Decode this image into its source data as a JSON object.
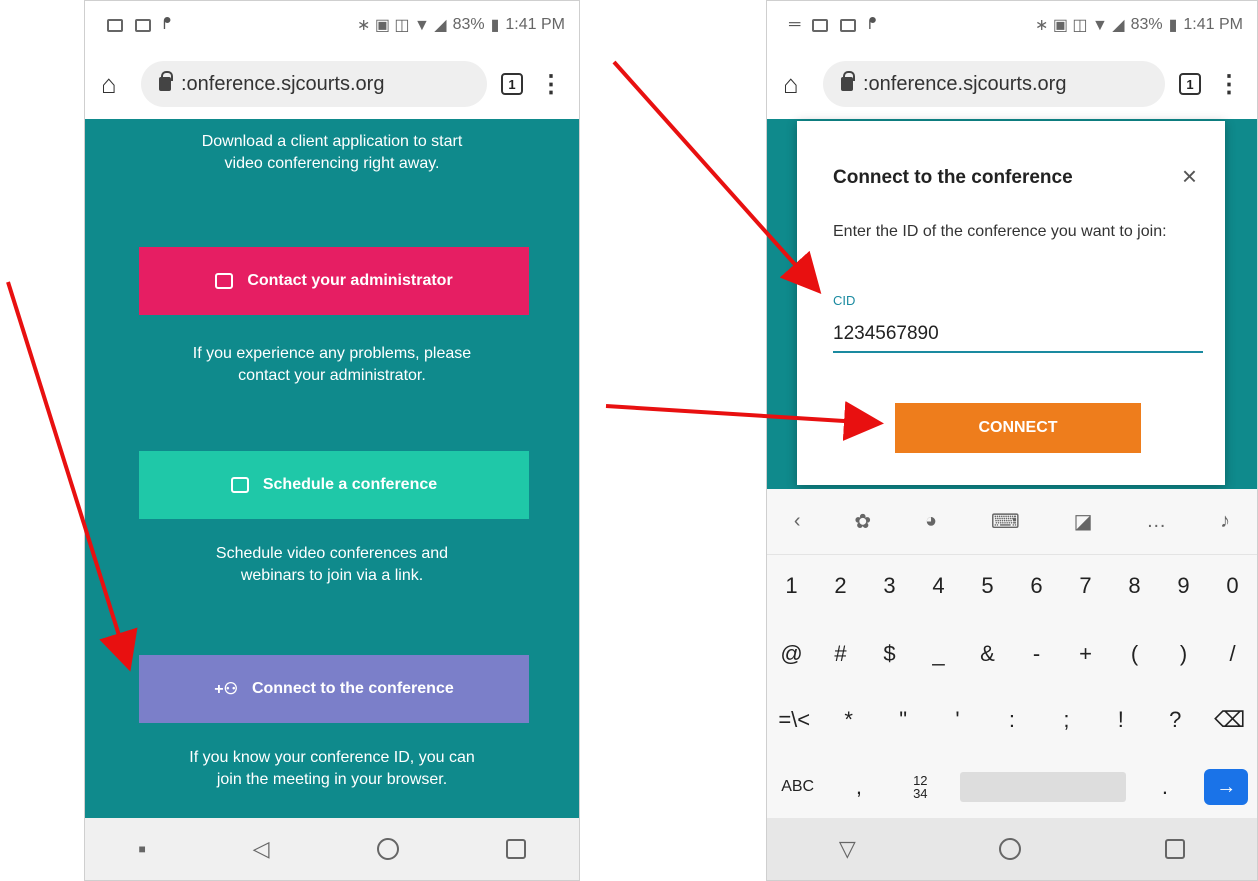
{
  "status": {
    "battery": "83%",
    "time": "1:41 PM"
  },
  "browser": {
    "url": ":onference.sjcourts.org",
    "tab_count": "1"
  },
  "left_screen": {
    "download_text_1": "Download a client application to start",
    "download_text_2": "video conferencing right away.",
    "contact_label": "Contact your administrator",
    "contact_desc_1": "If you experience any problems, please",
    "contact_desc_2": "contact your administrator.",
    "schedule_label": "Schedule a conference",
    "schedule_desc_1": "Schedule video conferences and",
    "schedule_desc_2": "webinars to join via a link.",
    "connect_label": "Connect to the conference",
    "connect_desc_1": "If you know your conference ID, you can",
    "connect_desc_2": "join the meeting in your browser."
  },
  "dialog": {
    "title": "Connect to the conference",
    "close": "×",
    "description": "Enter the ID of the conference you want to join:",
    "field_label": "CID",
    "field_value": "1234567890",
    "button": "CONNECT"
  },
  "keyboard": {
    "row1": [
      "1",
      "2",
      "3",
      "4",
      "5",
      "6",
      "7",
      "8",
      "9",
      "0"
    ],
    "row2": [
      "@",
      "#",
      "$",
      "_",
      "&",
      "-",
      "+",
      "(",
      ")",
      "/"
    ],
    "row3": [
      "=\\<",
      "*",
      "\"",
      "'",
      ":",
      ";",
      "!",
      "?",
      "⌫"
    ],
    "abc": "ABC",
    "comma": ",",
    "numpad": "12\n34",
    "period": ".",
    "enter": "→"
  },
  "colors": {
    "teal": "#0f8a8c",
    "contact": "#e61e63",
    "schedule": "#1fc8a8",
    "connect": "#7b7fc9",
    "connect_btn": "#ee7d1c",
    "arrow": "#e81010"
  }
}
